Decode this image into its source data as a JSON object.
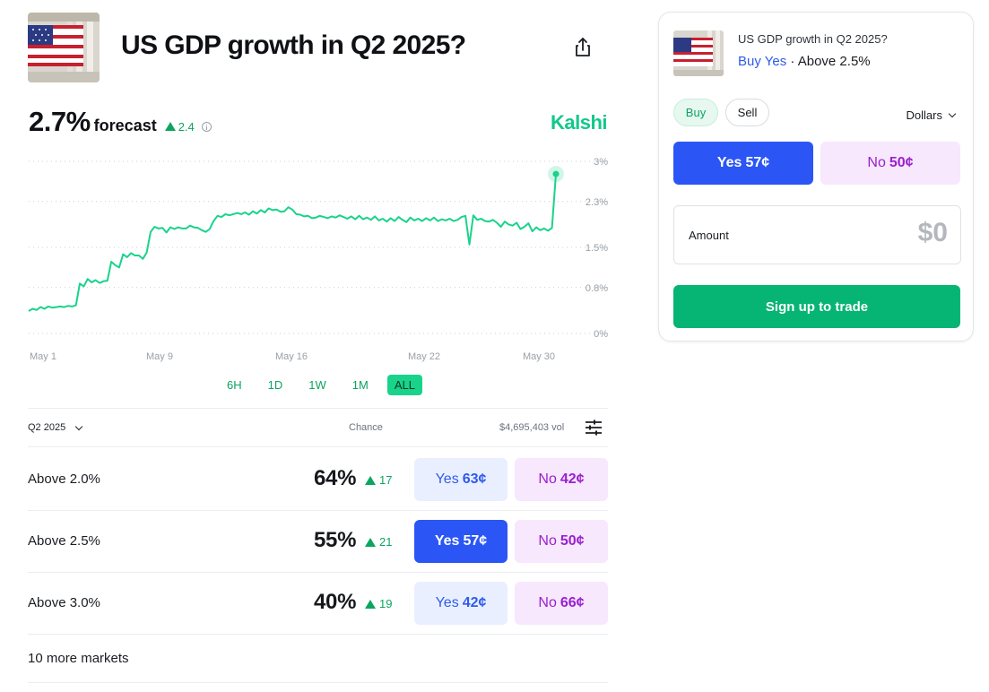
{
  "header": {
    "title": "US GDP growth in Q2 2025?",
    "image_icon": "us-flag-building-image",
    "share_icon": "share-icon"
  },
  "forecast": {
    "value": "2.7%",
    "word": "forecast",
    "delta": "2.4",
    "brand": "Kalshi"
  },
  "chart_data": {
    "type": "line",
    "y_tick_labels": [
      "3%",
      "2.3%",
      "1.5%",
      "0.8%",
      "0%"
    ],
    "y_ticks": [
      3,
      2.3,
      1.5,
      0.8,
      0
    ],
    "ylim": [
      0,
      3
    ],
    "x_tick_labels": [
      "May 1",
      "May 9",
      "May 16",
      "May 22",
      "May 30"
    ],
    "grid": true,
    "line_color": "#19d38b",
    "series": [
      {
        "values": [
          0.39,
          0.43,
          0.41,
          0.46,
          0.43,
          0.47,
          0.45,
          0.46,
          0.47,
          0.46,
          0.48,
          0.47,
          0.49,
          0.87,
          0.82,
          0.95,
          0.89,
          0.93,
          0.88,
          0.91,
          0.92,
          1.25,
          1.19,
          1.15,
          1.38,
          1.33,
          1.4,
          1.36,
          1.36,
          1.3,
          1.41,
          1.77,
          1.86,
          1.83,
          1.84,
          1.76,
          1.85,
          1.82,
          1.85,
          1.83,
          1.83,
          1.88,
          1.85,
          1.84,
          1.8,
          1.77,
          1.82,
          1.96,
          2.05,
          2.03,
          2.08,
          2.06,
          2.08,
          2.1,
          2.08,
          2.11,
          2.07,
          2.13,
          2.09,
          2.15,
          2.11,
          2.18,
          2.15,
          2.16,
          2.12,
          2.13,
          2.2,
          2.16,
          2.08,
          2.07,
          2.04,
          2.05,
          2.01,
          2.02,
          2.05,
          2.03,
          2.01,
          2.04,
          2.02,
          2.06,
          2.03,
          2.0,
          2.04,
          1.99,
          2.05,
          1.99,
          2.02,
          1.98,
          2.04,
          1.97,
          2.0,
          1.95,
          2.01,
          1.96,
          2.03,
          1.98,
          1.94,
          2.02,
          1.97,
          2.0,
          1.96,
          2.01,
          1.97,
          2.02,
          1.96,
          1.99,
          1.97,
          2.0,
          1.96,
          1.98,
          2.03,
          2.05,
          1.55,
          2.06,
          1.98,
          2.0,
          1.96,
          1.95,
          1.98,
          1.93,
          1.86,
          1.95,
          1.9,
          1.88,
          1.93,
          1.82,
          1.86,
          1.92,
          1.78,
          1.85,
          1.8,
          1.83,
          1.79,
          1.84,
          2.78
        ]
      }
    ]
  },
  "ranges": [
    "6H",
    "1D",
    "1W",
    "1M",
    "ALL"
  ],
  "table": {
    "period": "Q2 2025",
    "chance_header": "Chance",
    "volume": "$4,695,403 vol",
    "rows": [
      {
        "label": "Above 2.0%",
        "chance": "64%",
        "delta": "17",
        "yes_label": "Yes",
        "yes_price": "63¢",
        "no_label": "No",
        "no_price": "42¢"
      },
      {
        "label": "Above 2.5%",
        "chance": "55%",
        "delta": "21",
        "yes_label": "Yes",
        "yes_price": "57¢",
        "no_label": "No",
        "no_price": "50¢"
      },
      {
        "label": "Above 3.0%",
        "chance": "40%",
        "delta": "19",
        "yes_label": "Yes",
        "yes_price": "42¢",
        "no_label": "No",
        "no_price": "66¢"
      }
    ],
    "more": "10 more markets"
  },
  "panel": {
    "title": "US GDP growth in Q2 2025?",
    "buy_yes": "Buy Yes",
    "separator": "·",
    "market": "Above 2.5%",
    "buy": "Buy",
    "sell": "Sell",
    "currency": "Dollars",
    "yes_label": "Yes",
    "yes_price": "57¢",
    "no_label": "No",
    "no_price": "50¢",
    "amount_label": "Amount",
    "amount_placeholder": "$0",
    "signup": "Sign up to trade"
  },
  "colors": {
    "accent_green": "#0ba560",
    "chart_line": "#19d38b",
    "yes_blue": "#2b56f5",
    "no_purple": "#9a1fcf"
  }
}
